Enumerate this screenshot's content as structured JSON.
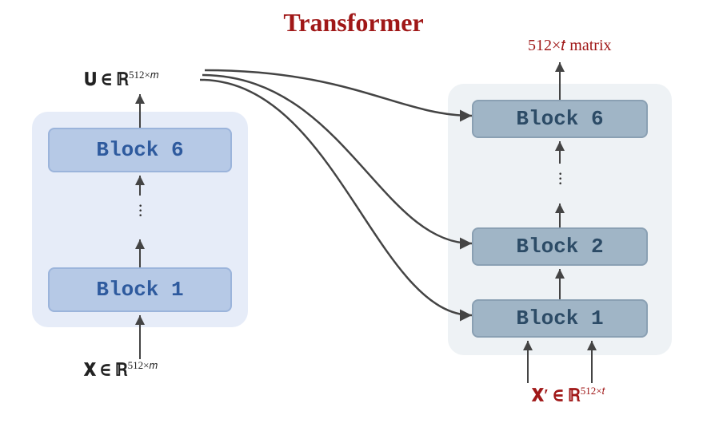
{
  "title": "Transformer",
  "encoder": {
    "output_label": "𝐔 ∈ ℝ",
    "output_sup": "512×𝑚",
    "blocks": {
      "top": "Block 6",
      "bottom": "Block 1"
    },
    "input_label": "𝐗 ∈ ℝ",
    "input_sup": "512×𝑚"
  },
  "decoder": {
    "output_label": "512×𝑡 matrix",
    "blocks": {
      "top": "Block 6",
      "mid": "Block 2",
      "bottom": "Block 1"
    },
    "input_label": "𝐗′ ∈ ℝ",
    "input_sup": "512×𝑡"
  }
}
